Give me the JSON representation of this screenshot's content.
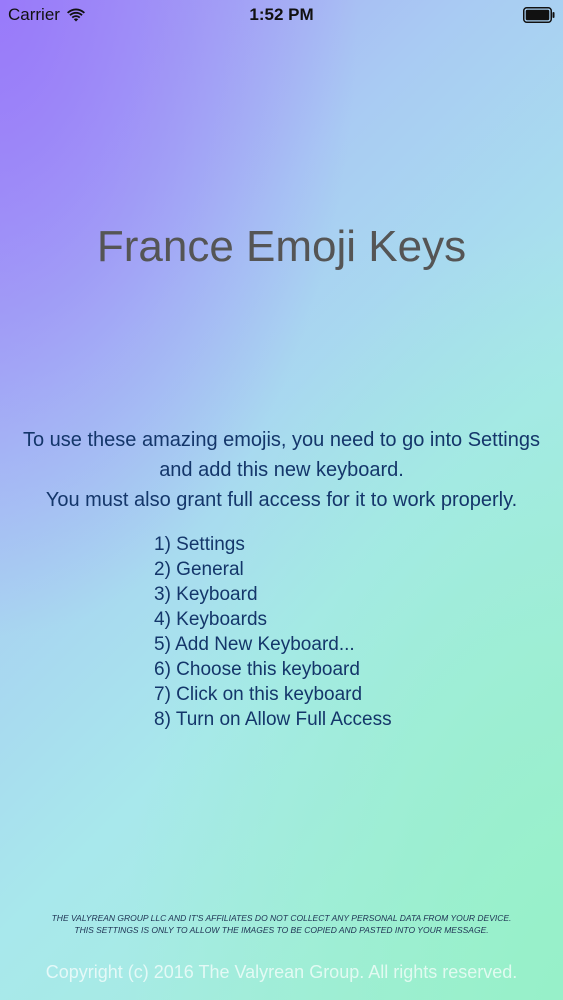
{
  "status_bar": {
    "carrier": "Carrier",
    "time": "1:52 PM",
    "icons": [
      "wifi-icon",
      "battery-icon"
    ]
  },
  "main": {
    "title": "France Emoji Keys",
    "intro_lines": [
      "To use these amazing emojis, you need to go into Settings",
      "and add this new keyboard.",
      "You must also grant full access for it to work properly."
    ],
    "steps": [
      "1) Settings",
      "2) General",
      "3) Keyboard",
      "4) Keyboards",
      "5) Add New Keyboard...",
      "6) Choose this keyboard",
      "7) Click on this keyboard",
      "8) Turn on Allow Full Access"
    ]
  },
  "footer": {
    "disclaimer_lines": [
      "THE VALYREAN GROUP LLC AND IT'S AFFILIATES DO NOT COLLECT ANY PERSONAL DATA FROM YOUR DEVICE.",
      "THIS SETTINGS IS ONLY TO ALLOW THE IMAGES TO BE COPIED AND PASTED INTO YOUR MESSAGE."
    ],
    "copyright": "Copyright (c) 2016 The Valyrean Group. All rights reserved."
  },
  "colors": {
    "gradient_top_left": "#9878fa",
    "gradient_bottom_right": "#96f0c8",
    "title": "#555555",
    "body_text": "#14366a"
  }
}
